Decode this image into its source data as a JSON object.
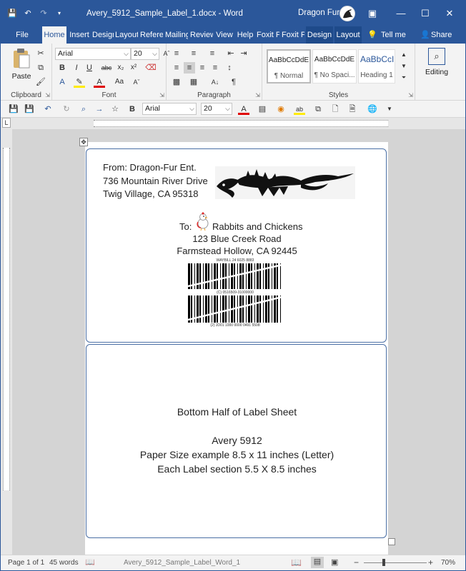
{
  "window": {
    "title": "Avery_5912_Sample_Label_1.docx  -  Word",
    "user": "Dragon Fur"
  },
  "tabs": [
    {
      "label": "File"
    },
    {
      "label": "Home"
    },
    {
      "label": "Insert"
    },
    {
      "label": "Design"
    },
    {
      "label": "Layout"
    },
    {
      "label": "References"
    },
    {
      "label": "Mailings"
    },
    {
      "label": "Review"
    },
    {
      "label": "View"
    },
    {
      "label": "Help"
    },
    {
      "label": "Foxit PDF"
    },
    {
      "label": "Foxit PDF"
    },
    {
      "label": "Design"
    },
    {
      "label": "Layout"
    }
  ],
  "tellme": "Tell me",
  "share": "Share",
  "ribbon": {
    "clipboard": {
      "label": "Clipboard",
      "paste": "Paste"
    },
    "font": {
      "label": "Font",
      "name": "Arial",
      "size": "20",
      "bold": "B",
      "italic": "I",
      "underline": "U",
      "strike": "abc",
      "sub": "x₂",
      "sup": "x²"
    },
    "paragraph": {
      "label": "Paragraph",
      "pilcrow": "¶"
    },
    "styles": {
      "label": "Styles",
      "items": [
        {
          "sample": "AaBbCcDdE",
          "name": "¶ Normal"
        },
        {
          "sample": "AaBbCcDdE",
          "name": "¶ No Spaci..."
        },
        {
          "sample": "AaBbCcI",
          "name": "Heading 1"
        }
      ]
    },
    "editing": {
      "label": "Editing"
    }
  },
  "qat": {
    "font": "Arial",
    "size": "20",
    "bold": "B"
  },
  "document": {
    "from_lines": [
      "From:  Dragon-Fur Ent.",
      "736 Mountain River Drive",
      "Twig Village, CA 95318"
    ],
    "to_prefix": "To:",
    "to_lines": [
      "Rabbits and Chickens",
      "123 Blue Creek Road",
      "Farmstead Hollow, CA 92445"
    ],
    "barcode": {
      "top": "WAYBILL 24 6025 8883",
      "mid": "(C) 0516509-31000000",
      "bottom": "(2) JD01 1000 0000 0491 5508"
    },
    "bottom_lines": [
      "Bottom Half of Label Sheet",
      "Avery 5912",
      "Paper Size example 8.5 x 11 inches (Letter)",
      "Each Label section 5.5 X 8.5 inches"
    ]
  },
  "status": {
    "page": "Page 1 of 1",
    "words": "45 words",
    "docname": "Avery_5912_Sample_Label_Word_1",
    "zoom": "70%"
  }
}
